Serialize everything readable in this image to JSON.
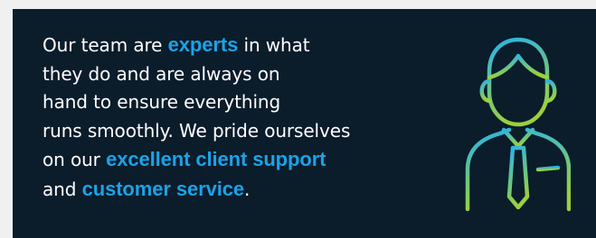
{
  "message": {
    "l1_a": "Our team are ",
    "l1_hl": "experts",
    "l1_b": " in what",
    "l2": "they do and are always on",
    "l3": "hand to ensure everything",
    "l4": "runs smoothly. We pride ourselves",
    "l5_a": "on our ",
    "l5_hl": "excellent client support",
    "l6_a": "and ",
    "l6_hl": "customer service",
    "l6_b": "."
  },
  "colors": {
    "background": "#0b1c2b",
    "highlight": "#1aa3e8",
    "icon_gradient_top": "#2ab3e6",
    "icon_gradient_bottom": "#9ad13c"
  },
  "icon": "support-person-icon"
}
